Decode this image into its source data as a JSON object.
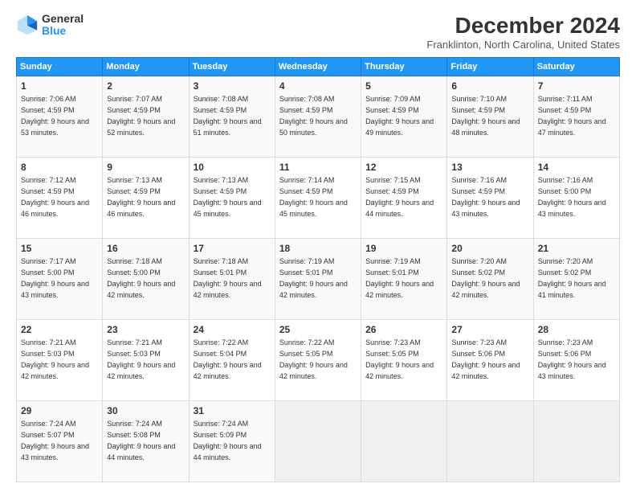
{
  "logo": {
    "general": "General",
    "blue": "Blue"
  },
  "title": "December 2024",
  "subtitle": "Franklinton, North Carolina, United States",
  "headers": [
    "Sunday",
    "Monday",
    "Tuesday",
    "Wednesday",
    "Thursday",
    "Friday",
    "Saturday"
  ],
  "weeks": [
    [
      {
        "day": "1",
        "sunrise": "Sunrise: 7:06 AM",
        "sunset": "Sunset: 4:59 PM",
        "daylight": "Daylight: 9 hours and 53 minutes."
      },
      {
        "day": "2",
        "sunrise": "Sunrise: 7:07 AM",
        "sunset": "Sunset: 4:59 PM",
        "daylight": "Daylight: 9 hours and 52 minutes."
      },
      {
        "day": "3",
        "sunrise": "Sunrise: 7:08 AM",
        "sunset": "Sunset: 4:59 PM",
        "daylight": "Daylight: 9 hours and 51 minutes."
      },
      {
        "day": "4",
        "sunrise": "Sunrise: 7:08 AM",
        "sunset": "Sunset: 4:59 PM",
        "daylight": "Daylight: 9 hours and 50 minutes."
      },
      {
        "day": "5",
        "sunrise": "Sunrise: 7:09 AM",
        "sunset": "Sunset: 4:59 PM",
        "daylight": "Daylight: 9 hours and 49 minutes."
      },
      {
        "day": "6",
        "sunrise": "Sunrise: 7:10 AM",
        "sunset": "Sunset: 4:59 PM",
        "daylight": "Daylight: 9 hours and 48 minutes."
      },
      {
        "day": "7",
        "sunrise": "Sunrise: 7:11 AM",
        "sunset": "Sunset: 4:59 PM",
        "daylight": "Daylight: 9 hours and 47 minutes."
      }
    ],
    [
      {
        "day": "8",
        "sunrise": "Sunrise: 7:12 AM",
        "sunset": "Sunset: 4:59 PM",
        "daylight": "Daylight: 9 hours and 46 minutes."
      },
      {
        "day": "9",
        "sunrise": "Sunrise: 7:13 AM",
        "sunset": "Sunset: 4:59 PM",
        "daylight": "Daylight: 9 hours and 46 minutes."
      },
      {
        "day": "10",
        "sunrise": "Sunrise: 7:13 AM",
        "sunset": "Sunset: 4:59 PM",
        "daylight": "Daylight: 9 hours and 45 minutes."
      },
      {
        "day": "11",
        "sunrise": "Sunrise: 7:14 AM",
        "sunset": "Sunset: 4:59 PM",
        "daylight": "Daylight: 9 hours and 45 minutes."
      },
      {
        "day": "12",
        "sunrise": "Sunrise: 7:15 AM",
        "sunset": "Sunset: 4:59 PM",
        "daylight": "Daylight: 9 hours and 44 minutes."
      },
      {
        "day": "13",
        "sunrise": "Sunrise: 7:16 AM",
        "sunset": "Sunset: 4:59 PM",
        "daylight": "Daylight: 9 hours and 43 minutes."
      },
      {
        "day": "14",
        "sunrise": "Sunrise: 7:16 AM",
        "sunset": "Sunset: 5:00 PM",
        "daylight": "Daylight: 9 hours and 43 minutes."
      }
    ],
    [
      {
        "day": "15",
        "sunrise": "Sunrise: 7:17 AM",
        "sunset": "Sunset: 5:00 PM",
        "daylight": "Daylight: 9 hours and 43 minutes."
      },
      {
        "day": "16",
        "sunrise": "Sunrise: 7:18 AM",
        "sunset": "Sunset: 5:00 PM",
        "daylight": "Daylight: 9 hours and 42 minutes."
      },
      {
        "day": "17",
        "sunrise": "Sunrise: 7:18 AM",
        "sunset": "Sunset: 5:01 PM",
        "daylight": "Daylight: 9 hours and 42 minutes."
      },
      {
        "day": "18",
        "sunrise": "Sunrise: 7:19 AM",
        "sunset": "Sunset: 5:01 PM",
        "daylight": "Daylight: 9 hours and 42 minutes."
      },
      {
        "day": "19",
        "sunrise": "Sunrise: 7:19 AM",
        "sunset": "Sunset: 5:01 PM",
        "daylight": "Daylight: 9 hours and 42 minutes."
      },
      {
        "day": "20",
        "sunrise": "Sunrise: 7:20 AM",
        "sunset": "Sunset: 5:02 PM",
        "daylight": "Daylight: 9 hours and 42 minutes."
      },
      {
        "day": "21",
        "sunrise": "Sunrise: 7:20 AM",
        "sunset": "Sunset: 5:02 PM",
        "daylight": "Daylight: 9 hours and 41 minutes."
      }
    ],
    [
      {
        "day": "22",
        "sunrise": "Sunrise: 7:21 AM",
        "sunset": "Sunset: 5:03 PM",
        "daylight": "Daylight: 9 hours and 42 minutes."
      },
      {
        "day": "23",
        "sunrise": "Sunrise: 7:21 AM",
        "sunset": "Sunset: 5:03 PM",
        "daylight": "Daylight: 9 hours and 42 minutes."
      },
      {
        "day": "24",
        "sunrise": "Sunrise: 7:22 AM",
        "sunset": "Sunset: 5:04 PM",
        "daylight": "Daylight: 9 hours and 42 minutes."
      },
      {
        "day": "25",
        "sunrise": "Sunrise: 7:22 AM",
        "sunset": "Sunset: 5:05 PM",
        "daylight": "Daylight: 9 hours and 42 minutes."
      },
      {
        "day": "26",
        "sunrise": "Sunrise: 7:23 AM",
        "sunset": "Sunset: 5:05 PM",
        "daylight": "Daylight: 9 hours and 42 minutes."
      },
      {
        "day": "27",
        "sunrise": "Sunrise: 7:23 AM",
        "sunset": "Sunset: 5:06 PM",
        "daylight": "Daylight: 9 hours and 42 minutes."
      },
      {
        "day": "28",
        "sunrise": "Sunrise: 7:23 AM",
        "sunset": "Sunset: 5:06 PM",
        "daylight": "Daylight: 9 hours and 43 minutes."
      }
    ],
    [
      {
        "day": "29",
        "sunrise": "Sunrise: 7:24 AM",
        "sunset": "Sunset: 5:07 PM",
        "daylight": "Daylight: 9 hours and 43 minutes."
      },
      {
        "day": "30",
        "sunrise": "Sunrise: 7:24 AM",
        "sunset": "Sunset: 5:08 PM",
        "daylight": "Daylight: 9 hours and 44 minutes."
      },
      {
        "day": "31",
        "sunrise": "Sunrise: 7:24 AM",
        "sunset": "Sunset: 5:09 PM",
        "daylight": "Daylight: 9 hours and 44 minutes."
      },
      null,
      null,
      null,
      null
    ]
  ]
}
